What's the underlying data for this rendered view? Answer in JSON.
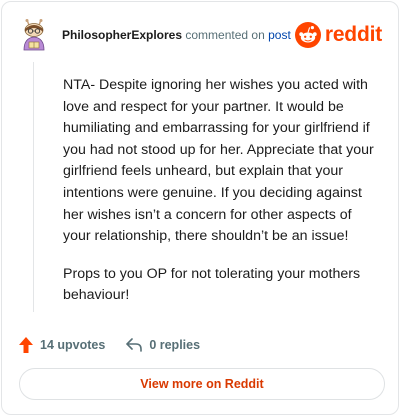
{
  "comment": {
    "author": "PhilosopherExplores",
    "action_text": "commented on",
    "post_link": "post",
    "brand": "reddit",
    "paragraphs": [
      "NTA- Despite ignoring her wishes you acted with love and respect for your partner. It would be humiliating and embarrassing for your girlfriend if you had not stood up for her. Appreciate that your girlfriend feels unheard, but explain that your intentions were genuine. If you deciding against her wishes isn’t a concern for other aspects of your relationship, there shouldn’t be an issue!",
      "Props to you OP for not tolerating your mothers behaviour!"
    ],
    "upvotes_label": "14 upvotes",
    "replies_label": "0 replies",
    "view_more_label": "View more on Reddit"
  },
  "icons": {
    "avatar": "snoo-avatar-icon",
    "brand": "reddit-logo-icon",
    "upvote": "upvote-arrow-icon",
    "reply": "reply-arrow-icon"
  },
  "colors": {
    "brand_orange": "#ff4500",
    "link_blue": "#0045ac",
    "muted": "#576f76",
    "view_more": "#d93900"
  }
}
